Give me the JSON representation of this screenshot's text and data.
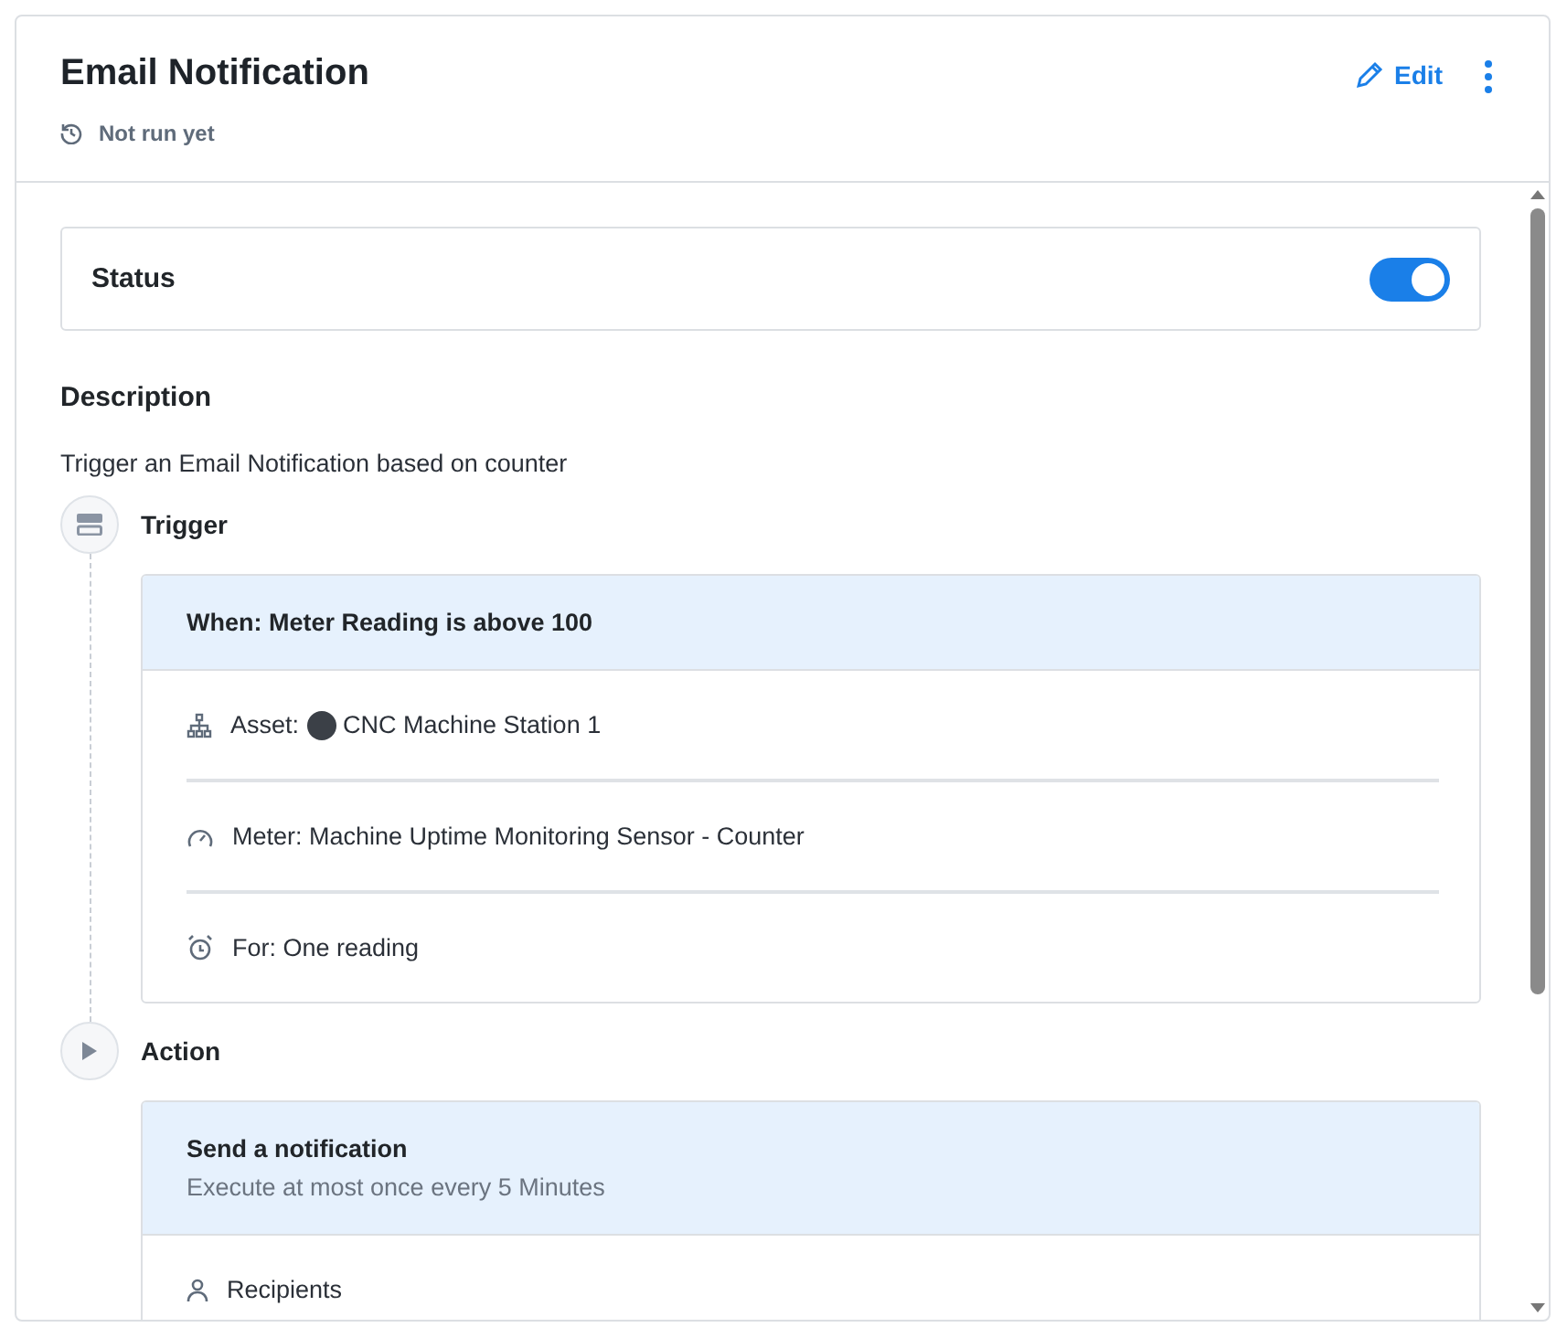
{
  "header": {
    "title": "Email Notification",
    "last_run": "Not run yet",
    "edit_label": "Edit"
  },
  "status": {
    "label": "Status",
    "on": true
  },
  "description": {
    "heading": "Description",
    "text": "Trigger an Email Notification based on counter"
  },
  "steps": [
    {
      "kind": "trigger",
      "label": "Trigger",
      "card": {
        "title": "When: Meter Reading is above 100",
        "rows": [
          {
            "kind": "asset",
            "label": "Asset:",
            "value": "CNC Machine Station 1"
          },
          {
            "kind": "meter",
            "text": "Meter: Machine Uptime Monitoring Sensor - Counter"
          },
          {
            "kind": "duration",
            "text": "For: One reading"
          }
        ]
      }
    },
    {
      "kind": "action",
      "label": "Action",
      "card": {
        "title": "Send a notification",
        "subtitle": "Execute at most once every 5 Minutes",
        "rows": [
          {
            "kind": "recipients",
            "text": "Recipients"
          }
        ]
      }
    }
  ]
}
